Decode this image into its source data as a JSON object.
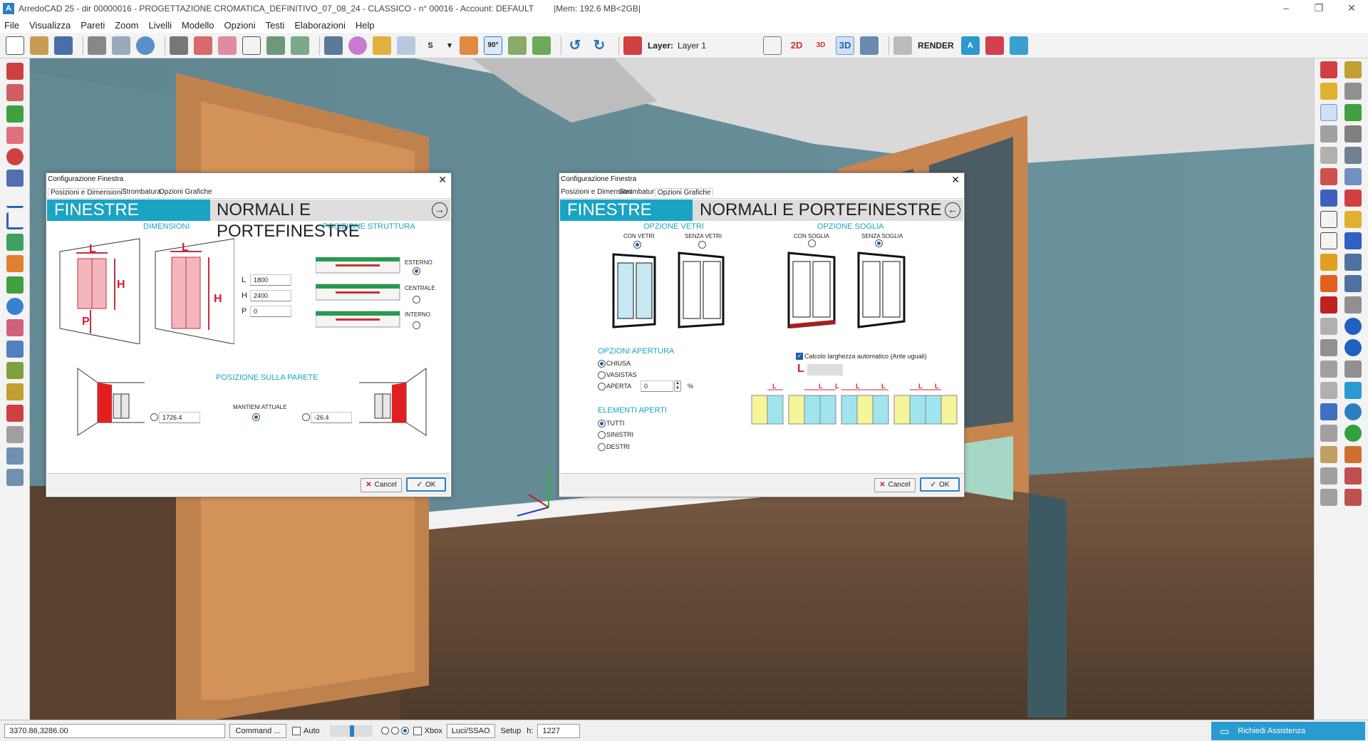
{
  "window": {
    "title": "ArredoCAD 25 - dir 00000016 - PROGETTAZIONE CROMATICA_DEFINITIVO_07_08_24 - CLASSICO - n° 00016 - Account: DEFAULT",
    "mem": "|Mem: 192.6 MB<2GB|",
    "app_letter": "A"
  },
  "menu": [
    "File",
    "Visualizza",
    "Pareti",
    "Zoom",
    "Livelli",
    "Modello",
    "Opzioni",
    "Testi",
    "Elaborazioni",
    "Help"
  ],
  "toolbar": {
    "s_label": "S",
    "angle_label": "90°",
    "layer_label": "Layer:",
    "layer_value": "Layer 1",
    "btn_2d": "2D",
    "btn_3d_small": "3D",
    "btn_3d": "3D",
    "render_label": "RENDER"
  },
  "status": {
    "coords": "3370.86,3286.00",
    "command": "Command ...",
    "auto": "Auto",
    "xbox": "Xbox",
    "luci": "Luci/SSAO",
    "setup": "Setup",
    "h_label": "h:",
    "h_value": "1227",
    "assist": "Richiedi Assistenza"
  },
  "dialog1": {
    "title": "Configurazione Finestra",
    "tabs": [
      "Posizioni e Dimensioni",
      "Strombatura",
      "Opzioni Grafiche"
    ],
    "banner_left": "FINESTRE",
    "banner_right": "NORMALI E PORTEFINESTRE",
    "nav_icon": "→",
    "dimensioni": "DIMENSIONI",
    "posizione_struttura": "POSIZIONE STRUTTURA",
    "fig_labels": {
      "L": "L",
      "H": "H",
      "P": "P"
    },
    "fields": {
      "L_label": "L",
      "L_value": "1800",
      "H_label": "H",
      "H_value": "2400",
      "P_label": "P",
      "P_value": "0"
    },
    "struttura": {
      "esterno": "ESTERNO",
      "centrale": "CENTRALE",
      "interno": "INTERNO"
    },
    "posizione_parete": "POSIZIONE SULLA PARETE",
    "left_value": "1726.4",
    "mantieni": "MANTIENI ATTUALE",
    "right_value": "-26.4",
    "cancel": "Cancel",
    "ok": "OK"
  },
  "dialog2": {
    "title": "Configurazione Finestra",
    "tabs": [
      "Posizioni e Dimensioni",
      "Strombatura",
      "Opzioni Grafiche"
    ],
    "banner_left": "FINESTRE",
    "banner_right": "NORMALI E PORTEFINESTRE",
    "nav_icon": "←",
    "opzione_vetri": "OPZIONE VETRI",
    "con_vetri": "CON VETRI",
    "senza_vetri": "SENZA VETRI",
    "opzione_soglia": "OPZIONE SOGLIA",
    "con_soglia": "CON SOGLIA",
    "senza_soglia": "SENZA SOGLIA",
    "opzioni_apertura": "OPZIONI APERTURA",
    "chiusa": "CHIUSA",
    "vasistas": "VASISTAS",
    "aperta": "APERTA",
    "aperta_value": "0",
    "percent": "%",
    "elementi_aperti": "ELEMENTI APERTI",
    "tutti": "TUTTI",
    "sinistri": "SINISTRI",
    "destri": "DESTRI",
    "calcolo": "Calcolo larghezza automatico (Ante uguali)",
    "l_big": "L",
    "l_small": "L",
    "cancel": "Cancel",
    "ok": "OK"
  }
}
